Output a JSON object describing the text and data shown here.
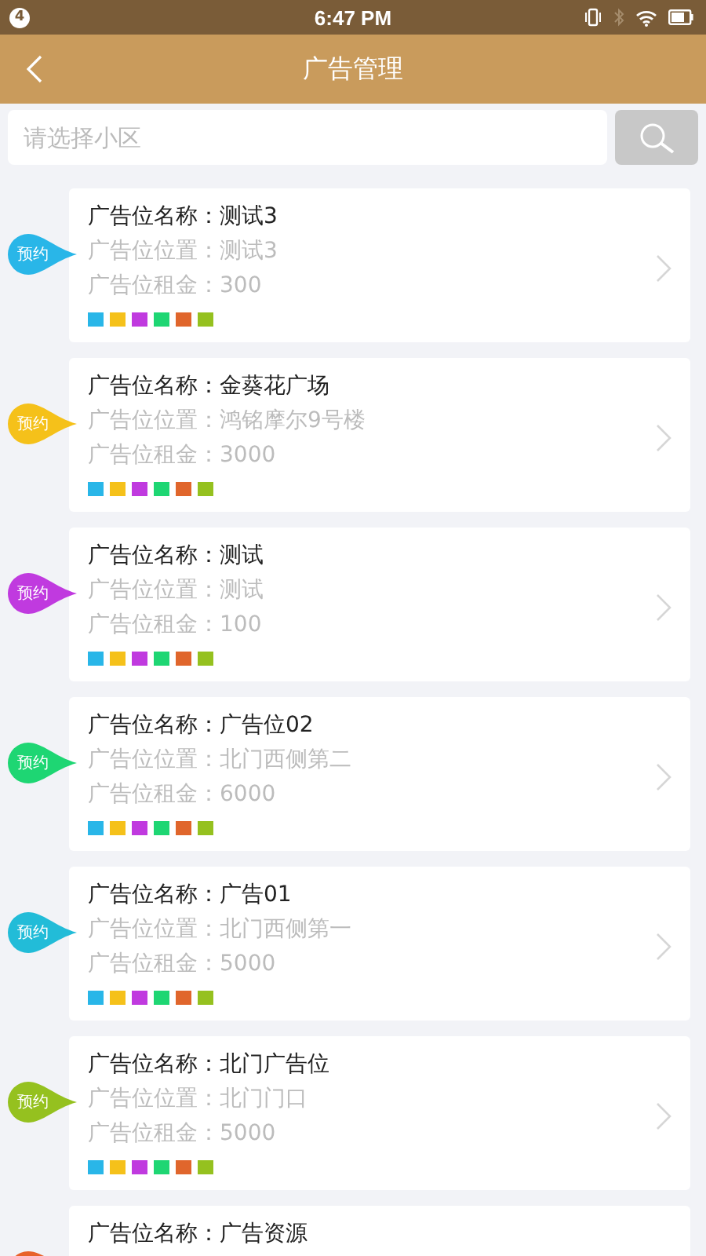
{
  "status_bar": {
    "notification_count": "4",
    "time": "6:47 PM"
  },
  "header": {
    "title": "广告管理"
  },
  "search": {
    "placeholder": "请选择小区"
  },
  "cards": [
    {
      "tag": "预约",
      "color": "#29b6e8",
      "name": "广告位名称：测试3",
      "location": "广告位位置：测试3",
      "rent": "广告位租金：300",
      "swatches": [
        {
          "color": "#29b6e8"
        },
        {
          "color": "#f5c11a"
        },
        {
          "color": "#c03adf"
        },
        {
          "color": "#1ed673"
        },
        {
          "color": "#e0662c"
        },
        {
          "color": "#95c11f"
        }
      ]
    },
    {
      "tag": "预约",
      "color": "#f5c11a",
      "name": "广告位名称：金葵花广场",
      "location": "广告位位置：鸿铭摩尔9号楼",
      "rent": "广告位租金：3000",
      "swatches": [
        {
          "color": "#29b6e8"
        },
        {
          "color": "#f5c11a"
        },
        {
          "color": "#c03adf"
        },
        {
          "color": "#1ed673"
        },
        {
          "color": "#e0662c"
        },
        {
          "color": "#95c11f"
        }
      ]
    },
    {
      "tag": "预约",
      "color": "#c03adf",
      "name": "广告位名称：测试",
      "location": "广告位位置：测试",
      "rent": "广告位租金：100",
      "swatches": [
        {
          "color": "#29b6e8"
        },
        {
          "color": "#f5c11a"
        },
        {
          "color": "#c03adf"
        },
        {
          "color": "#1ed673"
        },
        {
          "color": "#e0662c"
        },
        {
          "color": "#95c11f"
        }
      ]
    },
    {
      "tag": "预约",
      "color": "#1ed673",
      "name": "广告位名称：广告位02",
      "location": "广告位位置：北门西侧第二",
      "rent": "广告位租金：6000",
      "swatches": [
        {
          "color": "#29b6e8"
        },
        {
          "color": "#f5c11a"
        },
        {
          "color": "#c03adf"
        },
        {
          "color": "#1ed673"
        },
        {
          "color": "#e0662c"
        },
        {
          "color": "#95c11f"
        }
      ]
    },
    {
      "tag": "预约",
      "color": "#22bcd8",
      "name": "广告位名称：广告01",
      "location": "广告位位置：北门西侧第一",
      "rent": "广告位租金：5000",
      "swatches": [
        {
          "color": "#29b6e8"
        },
        {
          "color": "#f5c11a"
        },
        {
          "color": "#c03adf"
        },
        {
          "color": "#1ed673"
        },
        {
          "color": "#e0662c"
        },
        {
          "color": "#95c11f"
        }
      ]
    },
    {
      "tag": "预约",
      "color": "#95c11f",
      "name": "广告位名称：北门广告位",
      "location": "广告位位置：北门门口",
      "rent": "广告位租金：5000",
      "swatches": [
        {
          "color": "#29b6e8"
        },
        {
          "color": "#f5c11a"
        },
        {
          "color": "#c03adf"
        },
        {
          "color": "#1ed673"
        },
        {
          "color": "#e0662c"
        },
        {
          "color": "#95c11f"
        }
      ]
    },
    {
      "color": "#e8622a",
      "name": "广告位名称：广告资源"
    }
  ]
}
